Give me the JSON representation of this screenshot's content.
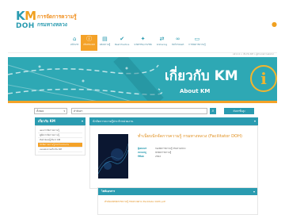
{
  "header": {
    "logo": {
      "km": "KM",
      "doh": "DOH",
      "line1": "การจัดการความรู้",
      "line2": "กรมทางหลวง"
    },
    "user_icon": "user-circle-icon"
  },
  "nav": {
    "items": [
      {
        "label": "หน้าแรก",
        "icon": "home-icon",
        "glyph": "⌂",
        "active": false
      },
      {
        "label": "เกี่ยวกับ KM",
        "icon": "info-icon",
        "glyph": "ⓘ",
        "active": true
      },
      {
        "label": "คลังความรู้",
        "icon": "book-icon",
        "glyph": "▤",
        "active": false
      },
      {
        "label": "Best Practice",
        "icon": "thumbs-up-icon",
        "glyph": "✔",
        "active": false
      },
      {
        "label": "นวัตกรรม/งานวิจัย",
        "icon": "lightbulb-icon",
        "glyph": "✦",
        "active": false
      },
      {
        "label": "K-Sharing",
        "icon": "share-icon",
        "glyph": "⇄",
        "active": false
      },
      {
        "label": "ลิงก์ภายนอก",
        "icon": "link-icon",
        "glyph": "∞",
        "active": false
      },
      {
        "label": "การจัดการความรู้",
        "icon": "monitor-icon",
        "glyph": "▭",
        "active": false
      }
    ]
  },
  "breadcrumb": "หน้าแรก > เกี่ยวกับ KM > ผู้อำนวยความสะดวก",
  "banner": {
    "title": "เกี่ยวกับ KM",
    "subtitle": "About KM",
    "accent": "#2ea8b4",
    "stripe_color": "#f4a228"
  },
  "search": {
    "select_value": "ทั้งหมด",
    "input_value": "คำค้นหา",
    "button_label": "ค้นหาขั้นสูง"
  },
  "sidebar": {
    "title": "เกี่ยวกับ KM",
    "items": [
      {
        "label": "แผนการจัดการความรู้",
        "active": false
      },
      {
        "label": "คู่มือการจัดการความรู้",
        "active": false
      },
      {
        "label": "ทีมนำคณะผู้บริหาร KM",
        "active": false
      },
      {
        "label": "นักจัดการความรู้ประจำหน่วยงาน",
        "active": true
      },
      {
        "label": "แบบสอบถามเกี่ยวกับ KM",
        "active": false
      }
    ]
  },
  "main": {
    "header": "นักจัดการความรู้ประจำหน่วยงาน",
    "title": "ทำเนียบนักจัดการความรู้ กรมทางหลวง (Facilitator DOH)",
    "meta": [
      {
        "key": "ผู้เผยแพร่",
        "value": "กองจัดการความรู้ กรมทางหลวง"
      },
      {
        "key": "หมวดหมู่",
        "value": "นักจัดการความรู้"
      },
      {
        "key": "ปีที่เผย",
        "value": "2562"
      }
    ]
  },
  "sub_panel": {
    "title": "ไฟล์เอกสาร",
    "line": "ทำเนียบนักจัดการความรู้ กรมทางหลวง (Facilitator DOH).pdf"
  }
}
